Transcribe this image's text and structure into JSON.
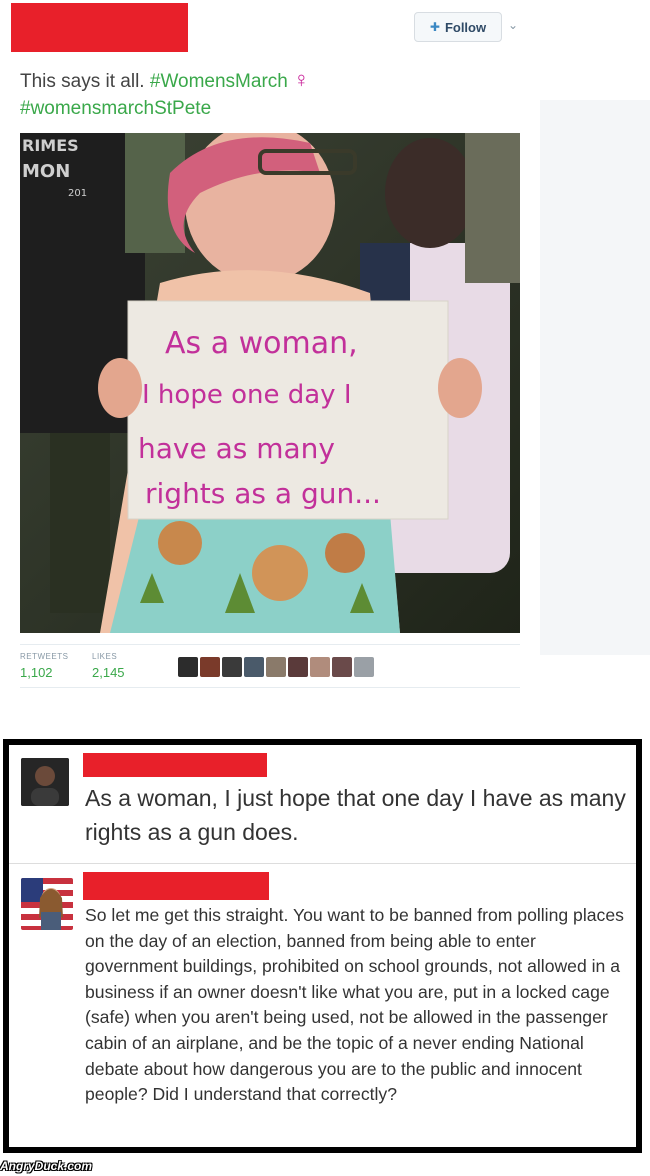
{
  "tweet": {
    "follow_label": "Follow",
    "text_prefix": "This says it all.",
    "hashtag_1": "#WomensMarch",
    "emoji": "♀",
    "hashtag_2": "#womensmarchStPete",
    "photo": {
      "shirt_text": [
        "RIMES",
        "MON",
        "201"
      ],
      "sign_lines": [
        "As a woman,",
        "I hope one day I",
        "have as many",
        "rights as a gun..."
      ],
      "sign_color": "#c2309a"
    },
    "stats": {
      "retweets_label": "RETWEETS",
      "retweets_value": "1,102",
      "likes_label": "LIKES",
      "likes_value": "2,145"
    },
    "colors": {
      "hashtag": "#3aa84a",
      "redaction": "#e8202a"
    }
  },
  "comments": [
    {
      "avatar": "dark-portrait-avatar",
      "text": "As a woman, I just hope that one day I have as many rights as a gun does."
    },
    {
      "avatar": "flag-portrait-avatar",
      "text": "So let me get this straight. You want to be banned from polling places on the day of an election, banned from being able to enter government buildings, prohibited on school grounds, not allowed in a business if an owner doesn't like what you are, put in a locked cage (safe) when you aren't being used, not be allowed in the passenger cabin of an airplane, and be the topic of a never ending National debate about how dangerous you are to the public and innocent people? Did I understand that correctly?"
    }
  ],
  "watermark": "AngryDuck.com"
}
